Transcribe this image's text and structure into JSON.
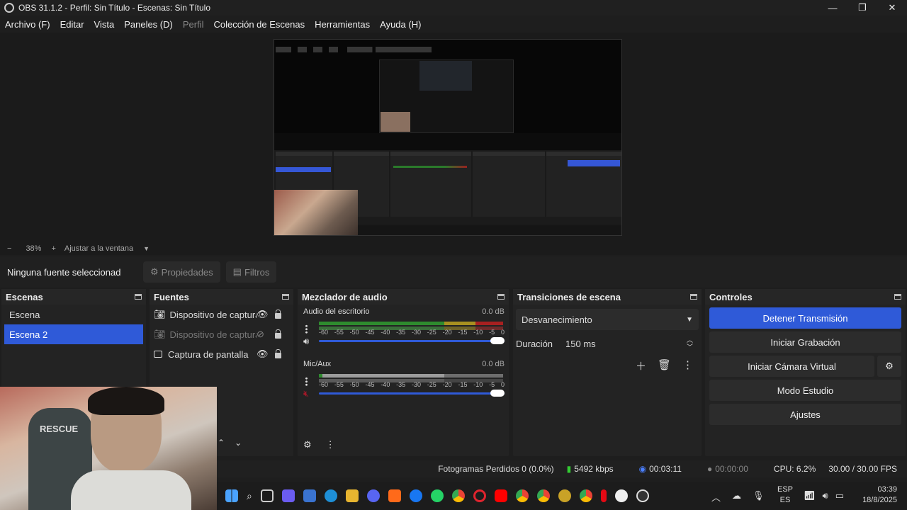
{
  "window": {
    "title": "OBS 31.1.2 - Perfil: Sin Título - Escenas: Sin Título"
  },
  "menu": {
    "items": [
      "Archivo (F)",
      "Editar",
      "Vista",
      "Paneles (D)",
      "Perfil",
      "Colección de Escenas",
      "Herramientas",
      "Ayuda (H)"
    ]
  },
  "zoom": {
    "minus": "−",
    "value": "38%",
    "plus": "+",
    "fit": "Ajustar a la ventana"
  },
  "source_toolbar": {
    "no_source": "Ninguna fuente seleccionad",
    "properties": "Propiedades",
    "filters": "Filtros"
  },
  "scenes": {
    "title": "Escenas",
    "items": [
      "Escena",
      "Escena 2"
    ],
    "selected": "Escena 2"
  },
  "sources": {
    "title": "Fuentes",
    "items": [
      {
        "label": "Dispositivo de captura de video",
        "visible": true
      },
      {
        "label": "Dispositivo de captura de audio",
        "visible": false
      },
      {
        "label": "Captura de pantalla",
        "visible": true
      }
    ]
  },
  "mixer": {
    "title": "Mezclador de audio",
    "channels": [
      {
        "name": "Audio del escritorio",
        "db": "0.0 dB",
        "level": 1.0
      },
      {
        "name": "Mic/Aux",
        "db": "0.0 dB",
        "level": 1.0
      }
    ],
    "ticks": [
      "-60",
      "-55",
      "-50",
      "-45",
      "-40",
      "-35",
      "-30",
      "-25",
      "-20",
      "-15",
      "-10",
      "-5",
      "0"
    ]
  },
  "transitions": {
    "title": "Transiciones de escena",
    "selected": "Desvanecimiento",
    "duration_label": "Duración",
    "duration_value": "150 ms"
  },
  "controls": {
    "title": "Controles",
    "buttons": [
      "Detener Transmisión",
      "Iniciar Grabación",
      "Iniciar Cámara Virtual",
      "Modo Estudio",
      "Ajustes"
    ]
  },
  "status": {
    "dropped": "Fotogramas Perdidos 0 (0.0%)",
    "bitrate": "5492 kbps",
    "stream_time": "00:03:11",
    "rec_time": "00:00:00",
    "cpu": "CPU: 6.2%",
    "fps": "30.00 / 30.00 FPS"
  },
  "taskbar": {
    "lang": "ESP",
    "lang_sub": "ES",
    "time": "03:39",
    "date": "18/8/2025"
  },
  "webcam_text": "RESCUE",
  "colors": {
    "accent": "#2f5ad8",
    "bg": "#1e1e1e",
    "dock": "#232323"
  }
}
